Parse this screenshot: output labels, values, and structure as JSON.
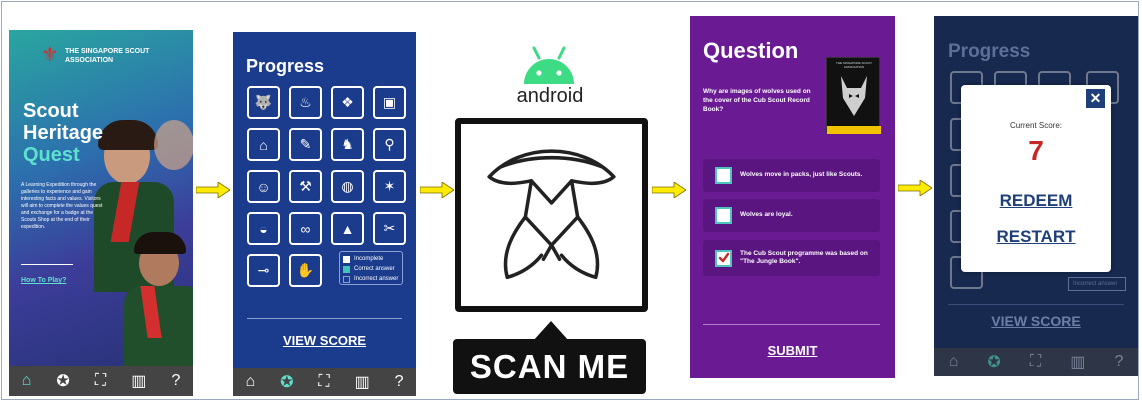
{
  "app_home": {
    "org_name": "THE SINGAPORE SCOUT ASSOCIATION",
    "title_line1": "Scout",
    "title_line2": "Heritage",
    "title_line3": "Quest",
    "description": "A Learning Expedition through the galleries to experience and gain interesting facts and values. Visitors will aim to complete the values quest and exchange for a badge at the Scouts Shop at the end of their expedition.",
    "how_to_play": "How To Play?"
  },
  "progress_screen": {
    "title": "Progress",
    "legend": [
      "Incomplete",
      "Correct answer",
      "Incorrect answer"
    ],
    "view_score": "VIEW SCORE"
  },
  "scan_panel": {
    "platform_label": "android",
    "scan_label": "SCAN ME"
  },
  "question_screen": {
    "title": "Question",
    "question": "Why are images of wolves used on the cover of the Cub Scout Record Book?",
    "options": [
      {
        "text": "Wolves move in packs, just like Scouts.",
        "checked": false
      },
      {
        "text": "Wolves are loyal.",
        "checked": false
      },
      {
        "text": "The Cub Scout programme was based on \"The Jungle Book\".",
        "checked": true
      }
    ],
    "submit": "SUBMIT",
    "book_cover_text": "THE SINGAPORE SCOUT ASSOCIATION"
  },
  "score_screen": {
    "title": "Progress",
    "score_label": "Current Score:",
    "score_value": "7",
    "redeem": "REDEEM",
    "restart": "RESTART",
    "view_score": "VIEW SCORE",
    "legend_fragment": "Incorrect answer"
  },
  "colors": {
    "navy": "#1b3b8c",
    "purple": "#6a1b94",
    "teal": "#40c4b8",
    "arrow": "#ffeb00",
    "score_red": "#c62828",
    "redeem_blue": "#1f3f7a"
  }
}
